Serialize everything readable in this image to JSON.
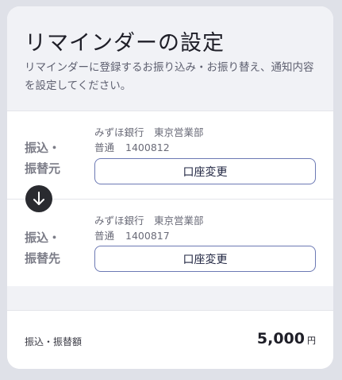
{
  "header": {
    "title": "リマインダーの設定",
    "description": "リマインダーに登録するお振り込み・お振り替え、通知内容を設定してください。"
  },
  "source": {
    "label_line1": "振込・",
    "label_line2": "振替元",
    "bank": "みずほ銀行　東京営業部",
    "account_type": "普通",
    "account_number": "1400812",
    "change_label": "口座変更"
  },
  "arrow_icon": "arrow-down-icon",
  "destination": {
    "label_line1": "振込・",
    "label_line2": "振替先",
    "bank": "みずほ銀行　東京営業部",
    "account_type": "普通",
    "account_number": "1400817",
    "change_label": "口座変更"
  },
  "amount": {
    "label": "振込・振替額",
    "value": "5,000",
    "unit": "円"
  },
  "colors": {
    "background": "#dfe1e8",
    "header_bg": "#f1f2f6",
    "button_border": "#6c79b4",
    "arrow_bg": "#2a2b30"
  }
}
